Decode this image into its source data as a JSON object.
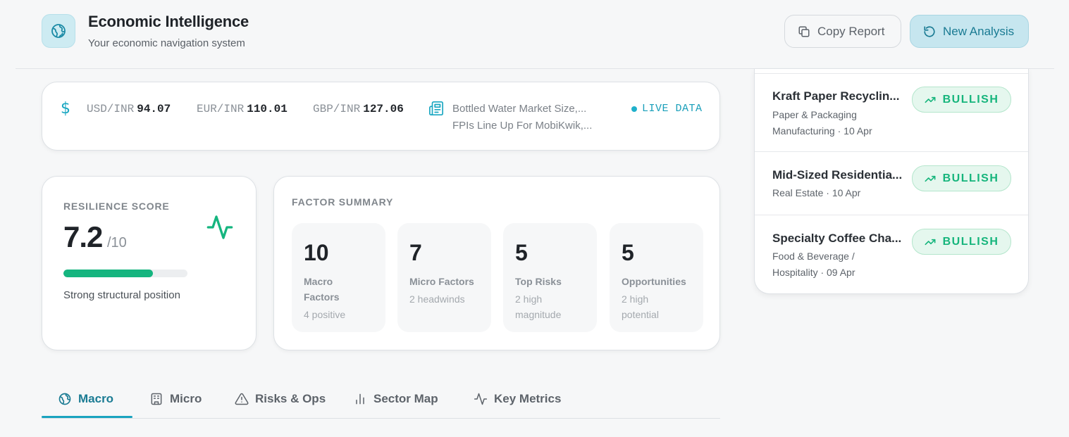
{
  "header": {
    "title": "Economic Intelligence",
    "subtitle": "Your economic navigation system",
    "copy_label": "Copy Report",
    "new_label": "New Analysis"
  },
  "ticker": {
    "rates": [
      {
        "pair": "USD/INR",
        "value": "94.07"
      },
      {
        "pair": "EUR/INR",
        "value": "110.01"
      },
      {
        "pair": "GBP/INR",
        "value": "127.06"
      }
    ],
    "news": [
      "Bottled Water Market Size,...",
      "FPIs Line Up For MobiKwik,..."
    ],
    "live_label": "LIVE DATA"
  },
  "resilience": {
    "label": "RESILIENCE SCORE",
    "score": "7.2",
    "max": "/10",
    "progress": 0.72,
    "note": "Strong structural position"
  },
  "factors": {
    "title": "FACTOR SUMMARY",
    "tiles": [
      {
        "num": "10",
        "label": "Macro Factors",
        "sub": "4 positive"
      },
      {
        "num": "7",
        "label": "Micro Factors",
        "sub": "2 headwinds"
      },
      {
        "num": "5",
        "label": "Top Risks",
        "sub": "2 high magnitude"
      },
      {
        "num": "5",
        "label": "Opportunities",
        "sub": "2 high potential"
      }
    ]
  },
  "tabs": [
    {
      "label": "Macro",
      "icon": "globe-icon",
      "active": true
    },
    {
      "label": "Micro",
      "icon": "building-icon",
      "active": false
    },
    {
      "label": "Risks & Ops",
      "icon": "warning-icon",
      "active": false
    },
    {
      "label": "Sector Map",
      "icon": "bar-chart-icon",
      "active": false
    },
    {
      "label": "Key Metrics",
      "icon": "activity-icon",
      "active": false
    }
  ],
  "sectors": [
    {
      "name": "Kraft Paper Recyclin...",
      "meta": "Paper & Packaging Manufacturing · 10 Apr",
      "badge": "BULLISH"
    },
    {
      "name": "Mid-Sized Residentia...",
      "meta": "Real Estate · 10 Apr",
      "badge": "BULLISH"
    },
    {
      "name": "Specialty Coffee Cha...",
      "meta": "Food & Beverage / Hospitality · 09 Apr",
      "badge": "BULLISH"
    }
  ],
  "colors": {
    "accent": "#1a7b93",
    "bullish": "#16b57c",
    "score_bar": "#15b57f"
  }
}
